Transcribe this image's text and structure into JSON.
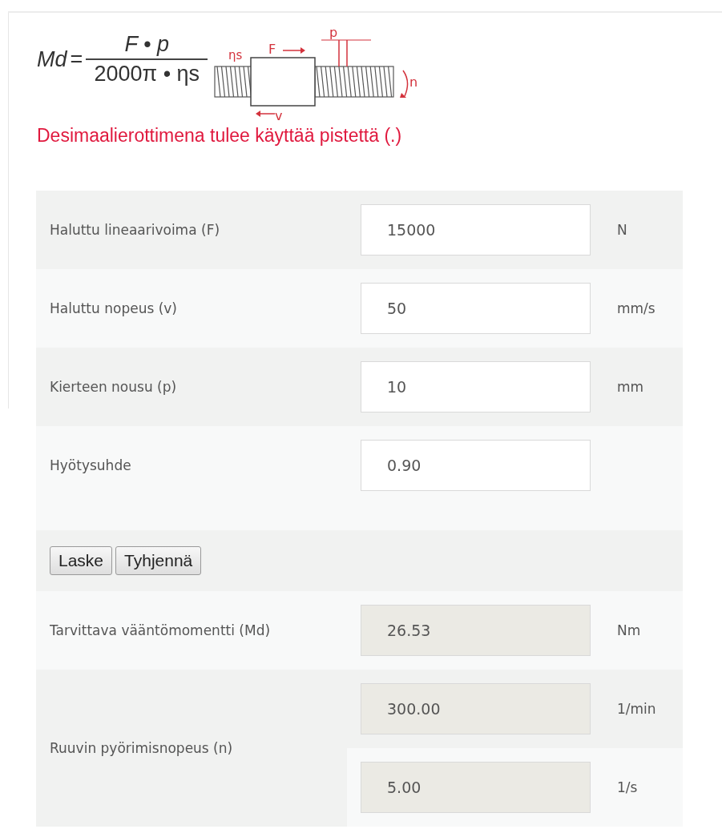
{
  "formula": {
    "lhs": "Md",
    "equals": "=",
    "numerator": "F • p",
    "denominator": "2000π • ηs"
  },
  "diagram": {
    "labels": [
      {
        "kind": "efficiency",
        "text": "ηs"
      },
      {
        "kind": "force",
        "text": "F"
      },
      {
        "kind": "pitch",
        "text": "p"
      },
      {
        "kind": "rotation",
        "text": "n"
      },
      {
        "kind": "velocity",
        "text": "v"
      }
    ]
  },
  "notice": "Desimaalierottimena tulee käyttää pistettä (.)",
  "inputs": [
    {
      "label": "Haluttu lineaarivoima (F)",
      "value": "15000",
      "unit": "N"
    },
    {
      "label": "Haluttu nopeus (v)",
      "value": "50",
      "unit": "mm/s"
    },
    {
      "label": "Kierteen nousu (p)",
      "value": "10",
      "unit": "mm"
    },
    {
      "label": "Hyötysuhde",
      "value": "0.90"
    }
  ],
  "buttons": [
    "Laske",
    "Tyhjennä"
  ],
  "results": [
    {
      "label": "Tarvittava vääntömomentti (Md)",
      "values": [
        {
          "value": "26.53",
          "unit": "Nm"
        }
      ]
    },
    {
      "label": "Ruuvin pyörimisnopeus (n)",
      "values": [
        {
          "value": "300.00",
          "unit": "1/min"
        },
        {
          "value": "5.00",
          "unit": "1/s"
        }
      ]
    }
  ]
}
